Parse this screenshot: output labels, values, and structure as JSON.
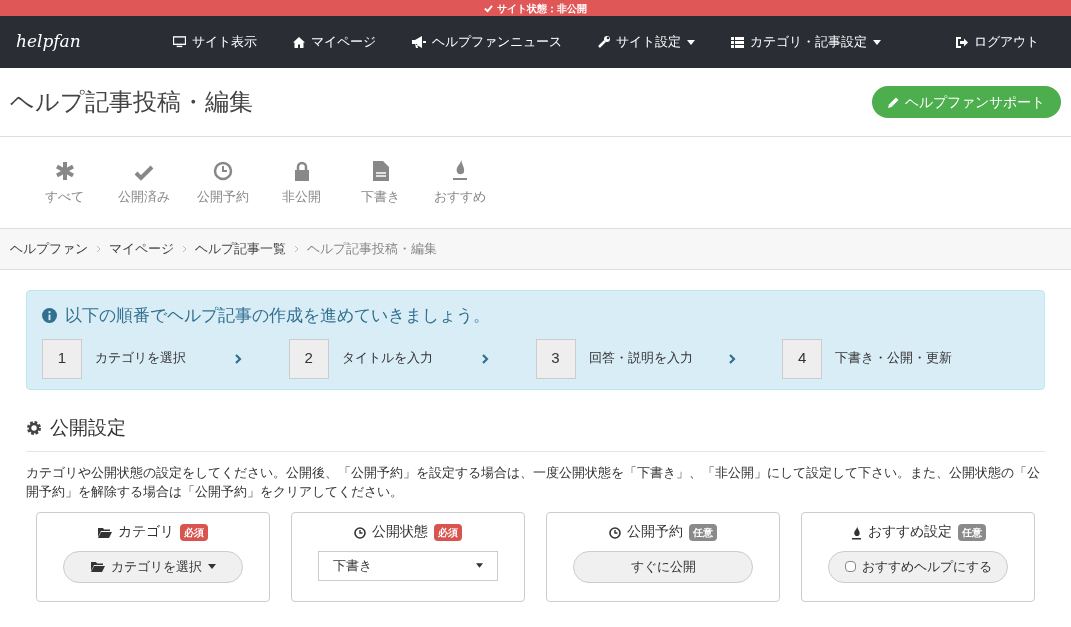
{
  "status_bar": {
    "text": "サイト状態：非公開"
  },
  "navbar": {
    "logo": "helpfan",
    "items": [
      {
        "label": "サイト表示",
        "dropdown": false
      },
      {
        "label": "マイページ",
        "dropdown": false
      },
      {
        "label": "ヘルプファンニュース",
        "dropdown": false
      },
      {
        "label": "サイト設定",
        "dropdown": true
      },
      {
        "label": "カテゴリ・記事設定",
        "dropdown": true
      }
    ],
    "logout": "ログアウト"
  },
  "page_title": "ヘルプ記事投稿・編集",
  "support_button": "ヘルプファンサポート",
  "filters": [
    {
      "label": "すべて"
    },
    {
      "label": "公開済み"
    },
    {
      "label": "公開予約"
    },
    {
      "label": "非公開"
    },
    {
      "label": "下書き"
    },
    {
      "label": "おすすめ"
    }
  ],
  "breadcrumb": [
    "ヘルプファン",
    "マイページ",
    "ヘルプ記事一覧",
    "ヘルプ記事投稿・編集"
  ],
  "guide": {
    "title": "以下の順番でヘルプ記事の作成を進めていきましょう。",
    "steps": [
      {
        "number": "1",
        "label": "カテゴリを選択"
      },
      {
        "number": "2",
        "label": "タイトルを入力"
      },
      {
        "number": "3",
        "label": "回答・説明を入力"
      },
      {
        "number": "4",
        "label": "下書き・公開・更新"
      }
    ]
  },
  "section": {
    "title": "公開設定",
    "description": "カテゴリや公開状態の設定をしてください。公開後、「公開予約」を設定する場合は、一度公開状態を「下書き」、「非公開」にして設定して下さい。また、公開状態の「公開予約」を解除する場合は「公開予約」をクリアしてください。",
    "cards": [
      {
        "title": "カテゴリ",
        "badge": {
          "text": "必須",
          "kind": "required"
        },
        "control": {
          "kind": "dropdown",
          "label": "カテゴリを選択"
        }
      },
      {
        "title": "公開状態",
        "badge": {
          "text": "必須",
          "kind": "required"
        },
        "control": {
          "kind": "select",
          "label": "下書き"
        }
      },
      {
        "title": "公開予約",
        "badge": {
          "text": "任意",
          "kind": "optional"
        },
        "control": {
          "kind": "button",
          "label": "すぐに公開"
        }
      },
      {
        "title": "おすすめ設定",
        "badge": {
          "text": "任意",
          "kind": "optional"
        },
        "control": {
          "kind": "checkbox",
          "label": "おすすめヘルプにする",
          "checked": false
        }
      }
    ]
  }
}
